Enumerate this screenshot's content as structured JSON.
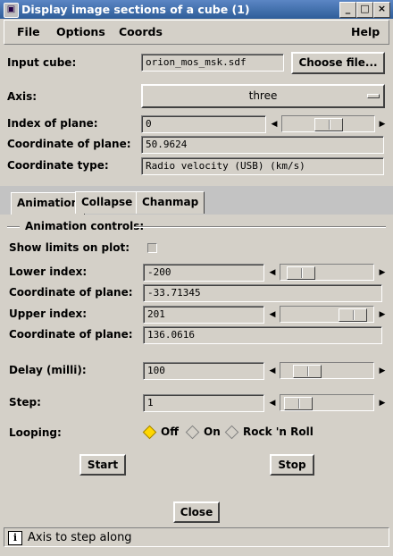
{
  "window": {
    "title": "Display image sections of a cube (1)",
    "controls": [
      "◦",
      "□",
      "×"
    ]
  },
  "menu": {
    "file": "File",
    "options": "Options",
    "coords": "Coords",
    "help": "Help"
  },
  "cube": {
    "input_label": "Input cube:",
    "input_value": "orion_mos_msk.sdf",
    "choose_label": "Choose file...",
    "axis_label": "Axis:",
    "axis_value": "three",
    "index_label": "Index of plane:",
    "index_value": "0",
    "index_slider_fraction": 0.5,
    "coord_label": "Coordinate of plane:",
    "coord_value": "50.9624",
    "coord_type_label": "Coordinate type:",
    "coord_type_value": "Radio velocity (USB) (km/s)"
  },
  "tabs": [
    "Animation",
    "Collapse",
    "Chanmap"
  ],
  "animation": {
    "group_title": "Animation controls:",
    "show_limits_label": "Show limits on plot:",
    "lower_index_label": "Lower index:",
    "lower_index_value": "-200",
    "lower_slider_fraction": 0.1,
    "lower_coord_label": "Coordinate of plane:",
    "lower_coord_value": "-33.71345",
    "upper_index_label": "Upper index:",
    "upper_index_value": "201",
    "upper_slider_fraction": 0.9,
    "upper_coord_label": "Coordinate of plane:",
    "upper_coord_value": "136.0616",
    "delay_label": "Delay (milli):",
    "delay_value": "100",
    "delay_slider_fraction": 0.2,
    "step_label": "Step:",
    "step_value": "1",
    "step_slider_fraction": 0.05,
    "looping_label": "Looping:",
    "looping_options": [
      "Off",
      "On",
      "Rock 'n Roll"
    ],
    "looping_selected": "Off",
    "start_label": "Start",
    "stop_label": "Stop"
  },
  "close_label": "Close",
  "status": {
    "icon": "info-icon",
    "text": "Axis to step along"
  }
}
